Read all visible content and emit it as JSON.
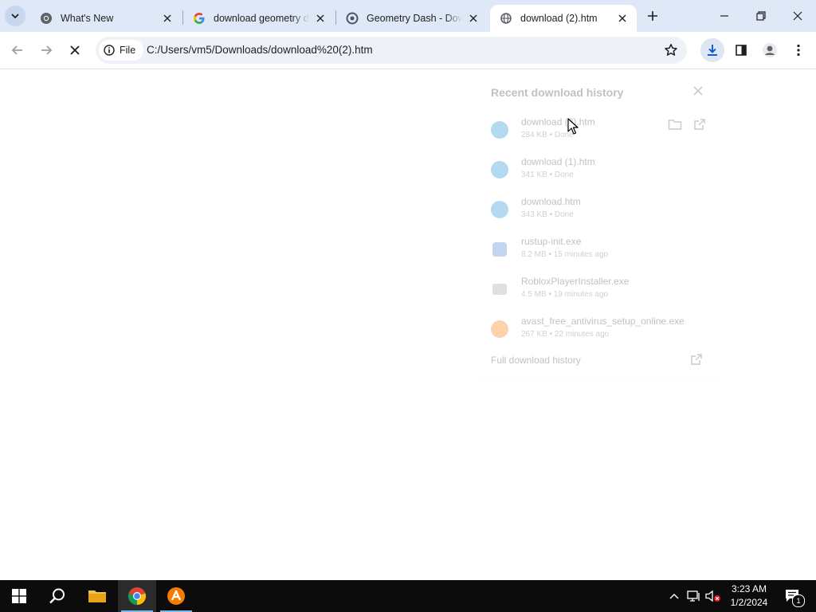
{
  "browser": {
    "tabs": [
      {
        "title": "What's New",
        "favicon": "chrome-icon",
        "active": false
      },
      {
        "title": "download geometry dash",
        "favicon": "google-icon",
        "active": false
      },
      {
        "title": "Geometry Dash - Download",
        "favicon": "geometry-dash-icon",
        "active": false
      },
      {
        "title": "download (2).htm",
        "favicon": "file-globe-icon",
        "active": true
      }
    ],
    "address": {
      "scheme_chip": "File",
      "url": "C:/Users/vm5/Downloads/download%20(2).htm"
    }
  },
  "downloads": {
    "title": "Recent download history",
    "items": [
      {
        "name": "download (2).htm",
        "meta": "284 KB • Done",
        "icon": "edge-file-icon",
        "color": "#1a8fd8"
      },
      {
        "name": "download (1).htm",
        "meta": "341 KB • Done",
        "icon": "edge-file-icon",
        "color": "#1a8fd8"
      },
      {
        "name": "download.htm",
        "meta": "343 KB • Done",
        "icon": "edge-file-icon",
        "color": "#1a8fd8"
      },
      {
        "name": "rustup-init.exe",
        "meta": "8.2 MB • 15 minutes ago",
        "icon": "exe-icon",
        "color": "#4a7fd4"
      },
      {
        "name": "RobloxPlayerInstaller.exe",
        "meta": "4.5 MB • 19 minutes ago",
        "icon": "roblox-icon",
        "color": "#9aa0a6"
      },
      {
        "name": "avast_free_antivirus_setup_online.exe",
        "meta": "267 KB • 22 minutes ago",
        "icon": "avast-icon",
        "color": "#f57c00"
      }
    ],
    "footer": "Full download history"
  },
  "taskbar": {
    "time": "3:23 AM",
    "date": "1/2/2024",
    "notification_count": "1"
  },
  "colors": {
    "tabstrip": "#dfe8f6",
    "taskbar": "#0c0c0c",
    "accent": "#1a73e8"
  }
}
